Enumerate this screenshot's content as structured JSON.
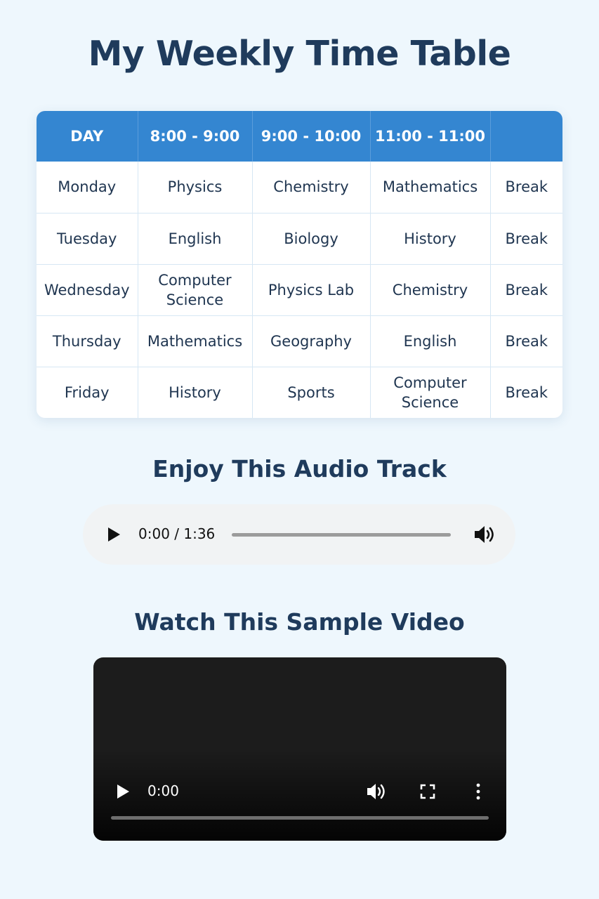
{
  "page": {
    "title": "My Weekly Time Table"
  },
  "timetable": {
    "headers": [
      "DAY",
      "8:00 - 9:00",
      "9:00 - 10:00",
      "11:00 - 11:00",
      ""
    ],
    "rows": [
      [
        "Monday",
        "Physics",
        "Chemistry",
        "Mathematics",
        "Break"
      ],
      [
        "Tuesday",
        "English",
        "Biology",
        "History",
        "Break"
      ],
      [
        "Wednesday",
        "Computer Science",
        "Physics Lab",
        "Chemistry",
        "Break"
      ],
      [
        "Thursday",
        "Mathematics",
        "Geography",
        "English",
        "Break"
      ],
      [
        "Friday",
        "History",
        "Sports",
        "Computer Science",
        "Break"
      ]
    ]
  },
  "audio_section": {
    "title": "Enjoy This Audio Track",
    "time": "0:00 / 1:36",
    "progress": 0,
    "icons": {
      "play": "play-icon",
      "volume": "volume-icon"
    }
  },
  "video_section": {
    "title": "Watch This Sample Video",
    "time": "0:00",
    "progress": 0,
    "icons": {
      "play": "play-icon",
      "volume": "volume-icon",
      "fullscreen": "fullscreen-icon",
      "more": "more-options-icon"
    }
  },
  "colors": {
    "background": "#eef7fd",
    "header": "#3486d1",
    "title": "#1f3b5c",
    "video_bg": "#1c1c1c"
  }
}
